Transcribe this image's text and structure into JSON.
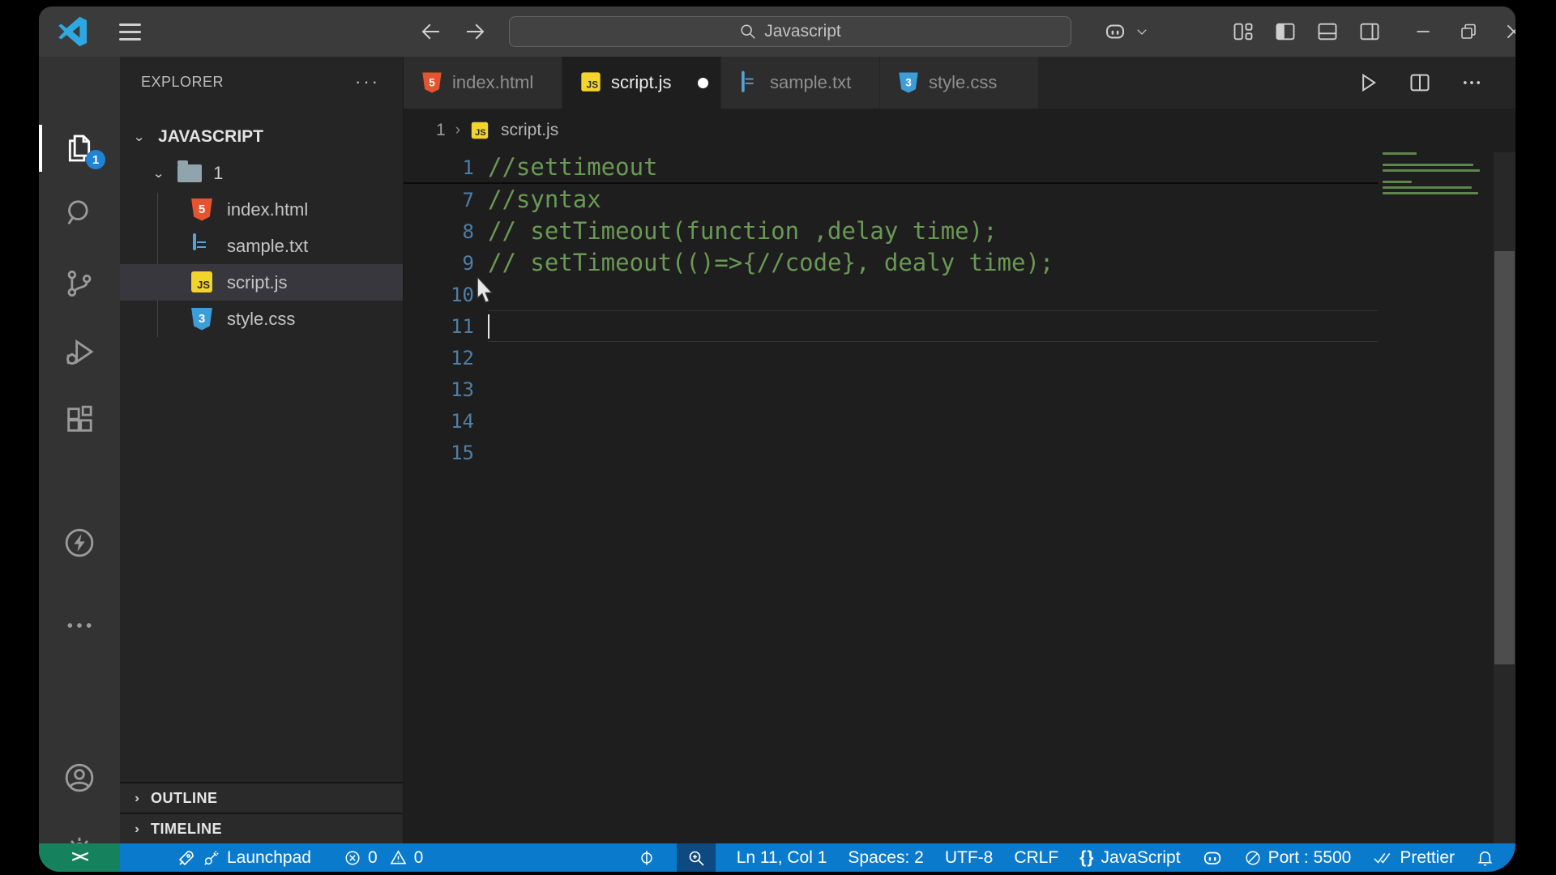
{
  "colors": {
    "statusbar_blue": "#0a7acc",
    "remote_green": "#16825d",
    "comment_green": "#6a9955",
    "line_number_blue": "#4d7fa8",
    "badge_blue": "#1e83d3"
  },
  "title_bar": {
    "search_value": "Javascript"
  },
  "activity_bar": {
    "explorer_badge": "1"
  },
  "sidebar": {
    "header": "EXPLORER",
    "header_more": "···",
    "workspace": "JAVASCRIPT",
    "folder": "1",
    "files": [
      {
        "name": "index.html",
        "type": "html"
      },
      {
        "name": "sample.txt",
        "type": "txt"
      },
      {
        "name": "script.js",
        "type": "js"
      },
      {
        "name": "style.css",
        "type": "css"
      }
    ],
    "panels": [
      {
        "label": "OUTLINE"
      },
      {
        "label": "TIMELINE"
      }
    ]
  },
  "tabs": [
    {
      "label": "index.html",
      "type": "html",
      "active": false,
      "modified": false
    },
    {
      "label": "script.js",
      "type": "js",
      "active": true,
      "modified": true
    },
    {
      "label": "sample.txt",
      "type": "txt",
      "active": false,
      "modified": false
    },
    {
      "label": "style.css",
      "type": "css",
      "active": false,
      "modified": false
    }
  ],
  "breadcrumb": {
    "folder": "1",
    "file": "script.js"
  },
  "editor": {
    "language_mode": "JavaScript",
    "lines": [
      {
        "num": "1",
        "text": "//settimeout"
      },
      {
        "num": "7",
        "text": "//syntax"
      },
      {
        "num": "8",
        "text": "// setTimeout(function ,delay time);"
      },
      {
        "num": "9",
        "text": "// setTimeout(()=>{//code}, dealy time);"
      },
      {
        "num": "10",
        "text": ""
      },
      {
        "num": "11",
        "text": ""
      },
      {
        "num": "12",
        "text": ""
      },
      {
        "num": "13",
        "text": ""
      },
      {
        "num": "14",
        "text": ""
      },
      {
        "num": "15",
        "text": ""
      }
    ],
    "cursor_line": "11",
    "folded_after_line": "1"
  },
  "status_bar": {
    "remote_glyph": "><",
    "launchpad": "Launchpad",
    "errors": "0",
    "warnings": "0",
    "cursor_position": "Ln 11, Col 1",
    "indentation": "Spaces: 2",
    "encoding": "UTF-8",
    "eol": "CRLF",
    "braces": "{}",
    "language": "JavaScript",
    "port": "Port : 5500",
    "formatter": "Prettier"
  }
}
